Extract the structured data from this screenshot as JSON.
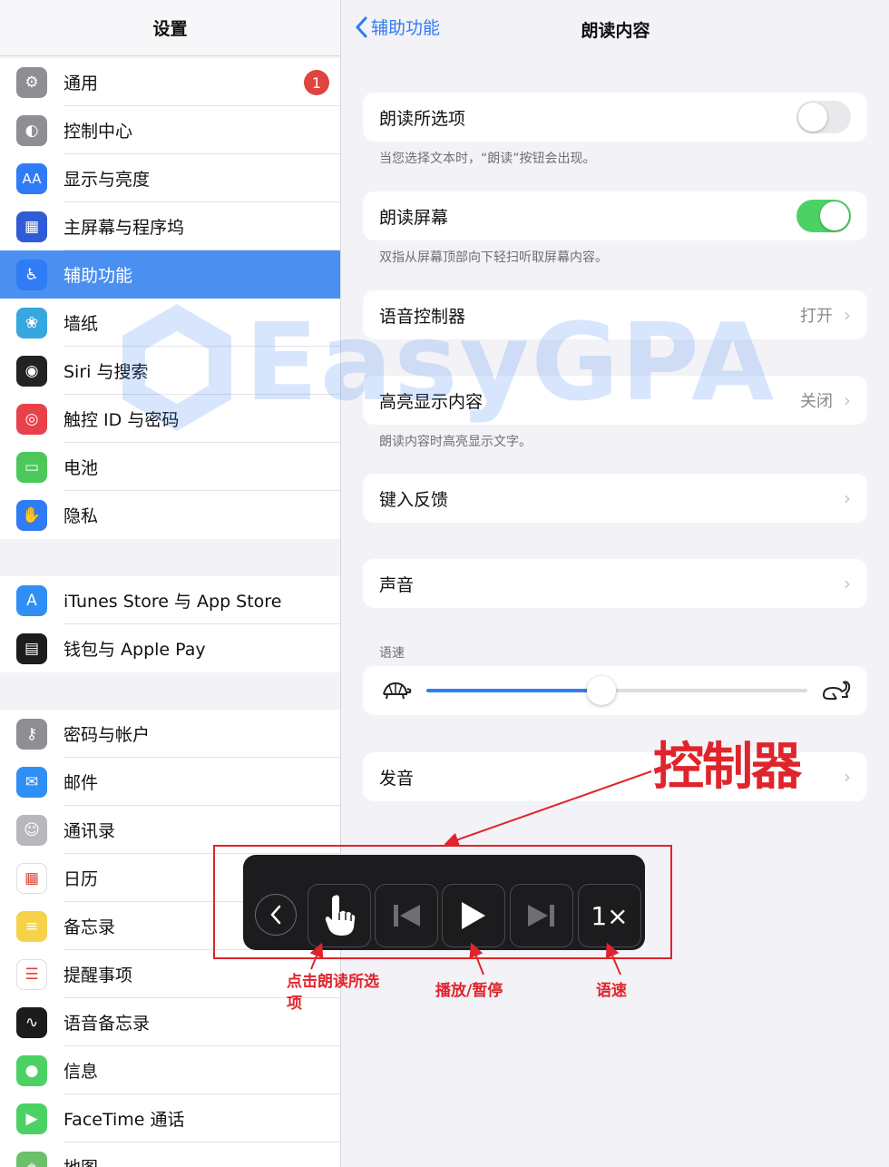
{
  "sidebar": {
    "title": "设置",
    "group1": [
      {
        "label": "通用",
        "icon": "gear-icon",
        "color": "#8e8e93",
        "badge": "1"
      },
      {
        "label": "控制中心",
        "icon": "toggles-icon",
        "color": "#8e8e93"
      },
      {
        "label": "显示与亮度",
        "icon": "text-size-icon",
        "color": "#2f7cf6"
      },
      {
        "label": "主屏幕与程序坞",
        "icon": "app-grid-icon",
        "color": "#2f5cd6"
      },
      {
        "label": "辅助功能",
        "icon": "accessibility-icon",
        "color": "#2f7cf6",
        "selected": true
      },
      {
        "label": "墙纸",
        "icon": "flower-icon",
        "color": "#36a8e0"
      },
      {
        "label": "Siri 与搜索",
        "icon": "siri-icon",
        "color": "#222222"
      },
      {
        "label": "触控 ID 与密码",
        "icon": "fingerprint-icon",
        "color": "#e8414b"
      },
      {
        "label": "电池",
        "icon": "battery-icon",
        "color": "#4cc85a"
      },
      {
        "label": "隐私",
        "icon": "hand-icon",
        "color": "#2f7cf6"
      }
    ],
    "group2": [
      {
        "label": "iTunes Store 与 App Store",
        "icon": "app-store-icon",
        "color": "#2f8ff6"
      },
      {
        "label": "钱包与 Apple Pay",
        "icon": "wallet-icon",
        "color": "#1c1c1e"
      }
    ],
    "group3": [
      {
        "label": "密码与帐户",
        "icon": "key-icon",
        "color": "#8e8e93"
      },
      {
        "label": "邮件",
        "icon": "mail-icon",
        "color": "#2f8ff6"
      },
      {
        "label": "通讯录",
        "icon": "contacts-icon",
        "color": "#b8b8bc"
      },
      {
        "label": "日历",
        "icon": "calendar-icon",
        "color": "#ffffff"
      },
      {
        "label": "备忘录",
        "icon": "notes-icon",
        "color": "#f5d24a"
      },
      {
        "label": "提醒事项",
        "icon": "reminders-icon",
        "color": "#ffffff"
      },
      {
        "label": "语音备忘录",
        "icon": "voice-memo-icon",
        "color": "#1c1c1e"
      },
      {
        "label": "信息",
        "icon": "message-icon",
        "color": "#4cd264"
      },
      {
        "label": "FaceTime 通话",
        "icon": "video-icon",
        "color": "#4cd264"
      },
      {
        "label": "地图",
        "icon": "map-icon",
        "color": "#6cc06a"
      }
    ]
  },
  "nav": {
    "back_label": "辅助功能",
    "title": "朗读内容"
  },
  "settings": {
    "speak_selection": {
      "label": "朗读所选项",
      "on": false,
      "footer": "当您选择文本时，“朗读”按钮会出现。"
    },
    "speak_screen": {
      "label": "朗读屏幕",
      "on": true,
      "footer": "双指从屏幕顶部向下轻扫听取屏幕内容。"
    },
    "speech_controller": {
      "label": "语音控制器",
      "value": "打开"
    },
    "highlight_content": {
      "label": "高亮显示内容",
      "value": "关闭",
      "footer": "朗读内容时高亮显示文字。"
    },
    "typing_feedback": {
      "label": "键入反馈"
    },
    "voices": {
      "label": "声音"
    },
    "speaking_rate": {
      "label": "语速",
      "value": 0.46
    },
    "pronunciations": {
      "label": "发音"
    }
  },
  "controller": {
    "speed_label": "1×"
  },
  "annotations": {
    "controller": "控制器",
    "select": "点击朗读所选项",
    "play_pause": "播放/暂停",
    "speed": "语速"
  },
  "watermark": {
    "text": "EasyGPA"
  },
  "colors": {
    "accent": "#2f7cf6",
    "toggle_on": "#4cd264",
    "annotation": "#e0242c",
    "badge": "#e0443e"
  }
}
